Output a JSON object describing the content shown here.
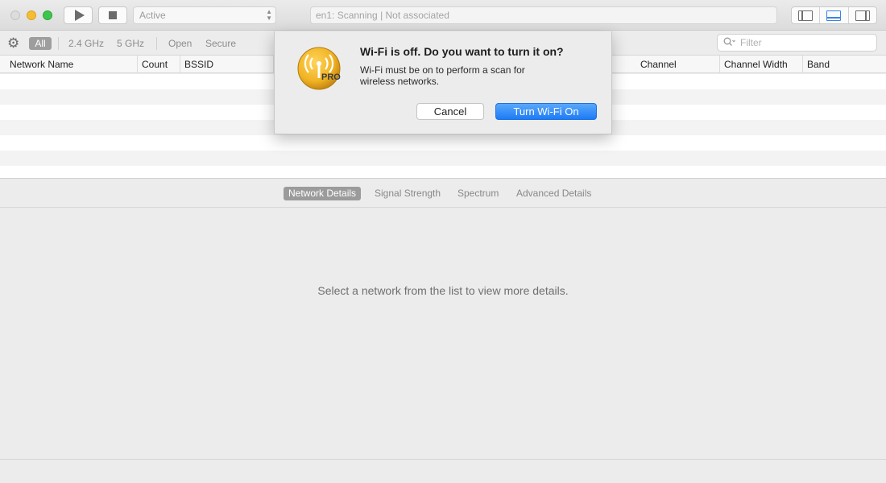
{
  "toolbar": {
    "interface_select": "Active",
    "status": "en1: Scanning  |  Not associated"
  },
  "filters": {
    "tabs": [
      "All",
      "2.4 GHz",
      "5 GHz",
      "Open",
      "Secure"
    ],
    "search_placeholder": "Filter"
  },
  "table": {
    "columns": [
      "Network Name",
      "Count",
      "BSSID",
      "Channel",
      "Channel Width",
      "Band"
    ]
  },
  "details": {
    "tabs": [
      "Network Details",
      "Signal Strength",
      "Spectrum",
      "Advanced Details"
    ],
    "active_tab": "Network Details",
    "placeholder": "Select a network from the list to view more details."
  },
  "dialog": {
    "icon_badge": "PRO",
    "title": "Wi-Fi is off. Do you want to turn it on?",
    "message": "Wi-Fi must be on to perform a scan for wireless networks.",
    "cancel_label": "Cancel",
    "confirm_label": "Turn Wi-Fi On"
  },
  "colors": {
    "accent": "#1c7bf5",
    "icon_gold": "#f0b323"
  }
}
